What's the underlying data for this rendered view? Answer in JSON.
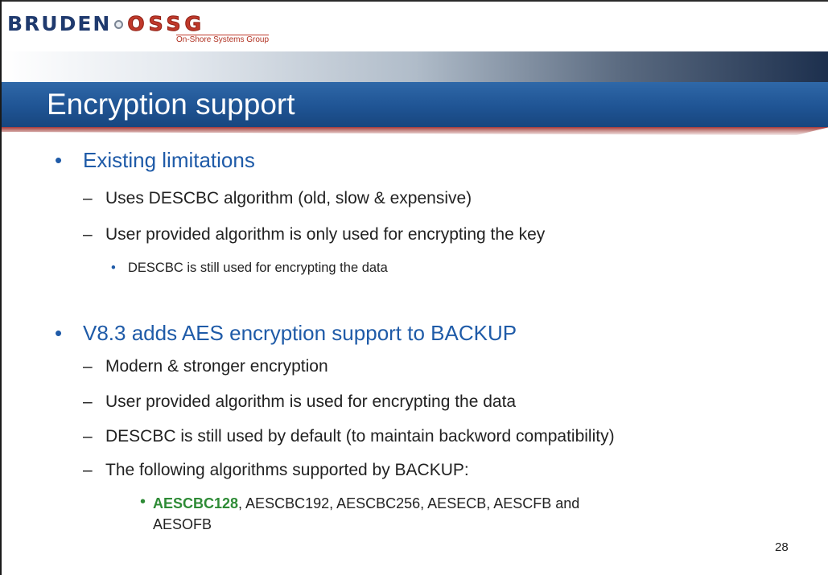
{
  "logo": {
    "brand_left": "BRUDEN",
    "brand_right": "OSSG",
    "subtitle": "On-Shore Systems Group"
  },
  "slide": {
    "title": "Encryption support",
    "page_number": "28"
  },
  "sections": [
    {
      "heading": "Existing limitations",
      "items": [
        {
          "text": "Uses DESCBC algorithm (old, slow & expensive)"
        },
        {
          "text": "User provided algorithm is only used for encrypting the key",
          "sub": [
            "DESCBC is still used for encrypting the data"
          ]
        }
      ]
    },
    {
      "heading": "V8.3 adds AES encryption support to BACKUP",
      "items": [
        {
          "text": "Modern & stronger encryption"
        },
        {
          "text": "User provided algorithm is used for encrypting the data"
        },
        {
          "text": "DESCBC is still used by default (to maintain backword compatibility)"
        },
        {
          "text": "The following algorithms supported by BACKUP:"
        }
      ],
      "algorithms": {
        "highlighted": "AESCBC128",
        "rest_line1": ", AESCBC192, AESCBC256, AESECB, AESCFB and",
        "rest_line2": "AESOFB"
      }
    }
  ],
  "bullet_symbols": {
    "level1": "•",
    "level2": "–",
    "level3": "•"
  },
  "colors": {
    "title_bar": "#1f5494",
    "heading_text": "#1f5ba8",
    "highlight_text": "#2e8b36"
  }
}
